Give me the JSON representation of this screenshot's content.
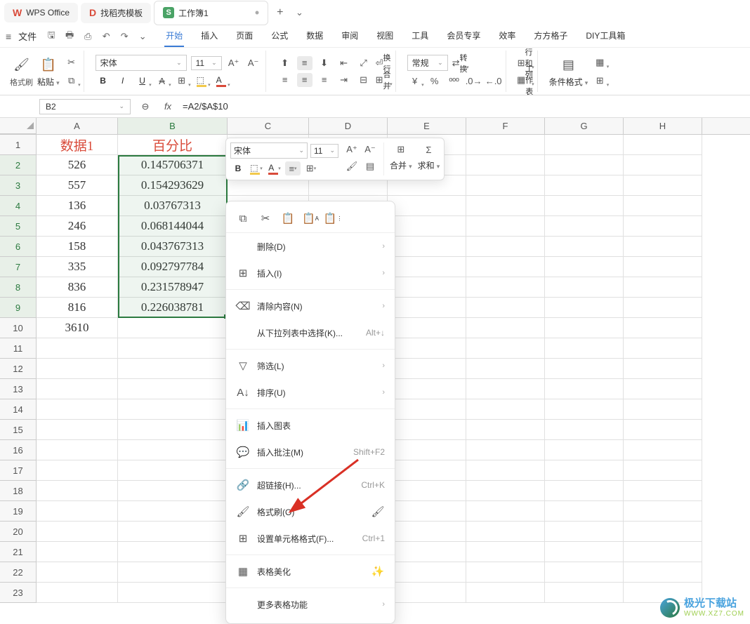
{
  "tabs": {
    "office": "WPS Office",
    "search": "找稻壳模板",
    "workbook": "工作簿1"
  },
  "menu": {
    "file": "文件",
    "items": [
      "开始",
      "插入",
      "页面",
      "公式",
      "数据",
      "审阅",
      "视图",
      "工具",
      "会员专享",
      "效率",
      "方方格子",
      "DIY工具箱"
    ]
  },
  "ribbon": {
    "fmtbrush": "格式刷",
    "paste": "粘贴",
    "font": "宋体",
    "size": "11",
    "normal": "常规",
    "convert": "转换",
    "rowscols": "行和列",
    "worksheet": "工作表",
    "condfmt": "条件格式",
    "wrap": "换行",
    "merge": "合并"
  },
  "namebox": "B2",
  "formula": "=A2/$A$10",
  "cols": [
    "A",
    "B",
    "C",
    "D",
    "E",
    "F",
    "G",
    "H"
  ],
  "headers": {
    "A": "数据1",
    "B": "百分比"
  },
  "data": {
    "A": [
      "526",
      "557",
      "136",
      "246",
      "158",
      "335",
      "836",
      "816",
      "3610"
    ],
    "B": [
      "0.145706371",
      "0.154293629",
      "0.03767313",
      "0.068144044",
      "0.043767313",
      "0.092797784",
      "0.231578947",
      "0.226038781"
    ]
  },
  "minitool": {
    "font": "宋体",
    "size": "11",
    "merge": "合并",
    "sum": "求和"
  },
  "ctx": {
    "delete": "删除(D)",
    "insert": "插入(I)",
    "clear": "清除内容(N)",
    "dropdown": "从下拉列表中选择(K)...",
    "dropsc": "Alt+↓",
    "filter": "筛选(L)",
    "sort": "排序(U)",
    "chart": "插入图表",
    "comment": "插入批注(M)",
    "commentsc": "Shift+F2",
    "link": "超链接(H)...",
    "linksc": "Ctrl+K",
    "brush": "格式刷(O)",
    "cellfmt": "设置单元格格式(F)...",
    "cellfmtsc": "Ctrl+1",
    "beautify": "表格美化",
    "more": "更多表格功能"
  },
  "watermark": {
    "cn": "极光下载站",
    "en": "WWW.XZ7.COM"
  }
}
